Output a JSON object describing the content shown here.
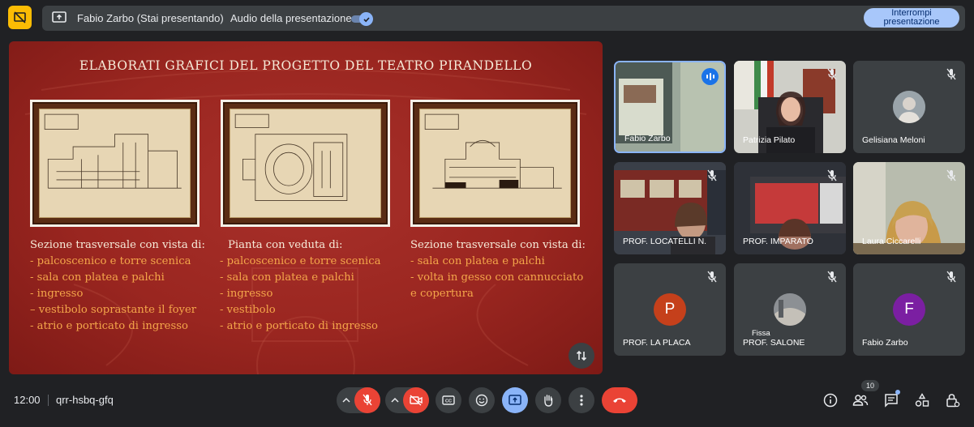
{
  "top": {
    "presenter_label": "Fabio Zarbo (Stai presentando)",
    "audio_label": "Audio della presentazione",
    "audio_on": true,
    "stop_button": "Interrompi presentazione"
  },
  "slide": {
    "title": "ELABORATI GRAFICI DEL PROGETTO DEL TEATRO PIRANDELLO",
    "columns": [
      {
        "heading": "Sezione trasversale con vista di:",
        "items": [
          "- palcoscenico e torre scenica",
          "- sala con platea e palchi",
          "- ingresso",
          "– vestibolo soprastante il foyer",
          "- atrio e porticato di ingresso"
        ]
      },
      {
        "heading": "Pianta con veduta di:",
        "items": [
          "- palcoscenico e torre scenica",
          "- sala con platea e palchi",
          "- ingresso",
          "- vestibolo",
          "- atrio e porticato di ingresso"
        ]
      },
      {
        "heading": "Sezione trasversale con vista di:",
        "items": [
          "- sala con platea e palchi",
          "- volta in gesso con cannucciato",
          "e copertura"
        ]
      }
    ]
  },
  "participants": [
    {
      "name": "Fabio Zarbo",
      "speaking": true
    },
    {
      "name": "Patrizia Pilato",
      "muted": true
    },
    {
      "name": "Gelisiana Meloni",
      "muted": true
    },
    {
      "name": "PROF. LOCATELLI N.",
      "muted": true
    },
    {
      "name": "PROF. IMPARATO",
      "muted": true
    },
    {
      "name": "Laura Ciccarelli",
      "muted": true
    },
    {
      "name": "PROF. LA PLACA",
      "initial": "P",
      "avatar_color": "#c5401b",
      "muted": true
    },
    {
      "name": "PROF. SALONE",
      "pin_label": "Fissa",
      "muted": true
    },
    {
      "name": "Fabio Zarbo",
      "initial": "F",
      "avatar_color": "#7b1fa2",
      "muted": true
    }
  ],
  "bottom": {
    "time": "12:00",
    "meeting_code": "qrr-hsbq-gfq",
    "participant_count": "10"
  },
  "icons": [
    "no-present-icon",
    "present-screen-icon",
    "mic-off-icon",
    "camera-off-icon",
    "captions-icon",
    "emoji-icon",
    "present-icon",
    "raise-hand-icon",
    "more-icon",
    "end-call-icon",
    "info-icon",
    "people-icon",
    "chat-icon",
    "activities-icon",
    "host-controls-icon",
    "swap-icon"
  ]
}
